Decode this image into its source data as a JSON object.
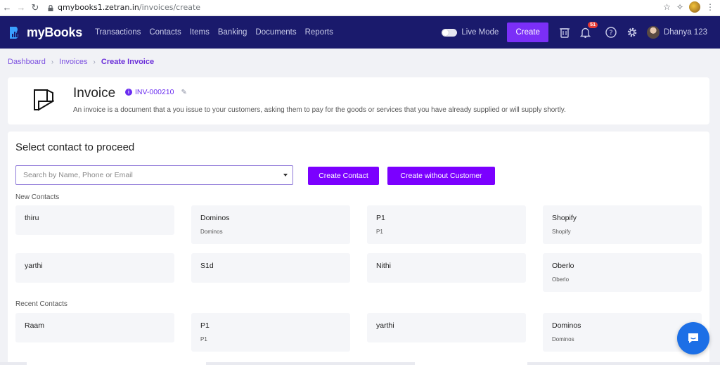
{
  "browser": {
    "url_host": "qmybooks1.zetran.in",
    "url_path": "/invoices/create"
  },
  "app": {
    "logo_text": "myBooks",
    "nav": [
      "Transactions",
      "Contacts",
      "Items",
      "Banking",
      "Documents",
      "Reports"
    ],
    "live_mode_label": "Live Mode",
    "create_label": "Create",
    "notification_count": "51",
    "username": "Dhanya 123"
  },
  "breadcrumb": {
    "items": [
      "Dashboard",
      "Invoices"
    ],
    "current": "Create Invoice"
  },
  "invoice": {
    "title": "Invoice",
    "id": "INV-000210",
    "description": "An invoice is a document that a you issue to your customers, asking them to pay for the goods or services that you have already supplied or will supply shortly."
  },
  "contact_select": {
    "title": "Select contact to proceed",
    "search_placeholder": "Search by Name, Phone or Email",
    "create_contact_label": "Create Contact",
    "create_without_customer_label": "Create without Customer",
    "new_contacts_label": "New Contacts",
    "recent_contacts_label": "Recent Contacts",
    "new_contacts": [
      {
        "name": "thiru",
        "sub": ""
      },
      {
        "name": "Dominos",
        "sub": "Dominos"
      },
      {
        "name": "P1",
        "sub": "P1"
      },
      {
        "name": "Shopify",
        "sub": "Shopify"
      },
      {
        "name": "yarthi",
        "sub": ""
      },
      {
        "name": "S1d",
        "sub": ""
      },
      {
        "name": "Nithi",
        "sub": ""
      },
      {
        "name": "Oberlo",
        "sub": "Oberlo"
      }
    ],
    "recent_contacts": [
      {
        "name": "Raam",
        "sub": ""
      },
      {
        "name": "P1",
        "sub": "P1"
      },
      {
        "name": "yarthi",
        "sub": ""
      },
      {
        "name": "Dominos",
        "sub": "Dominos"
      }
    ]
  },
  "colors": {
    "header_bg": "#1a1a6c",
    "accent": "#7b00ff",
    "chat": "#1c6fe6"
  }
}
